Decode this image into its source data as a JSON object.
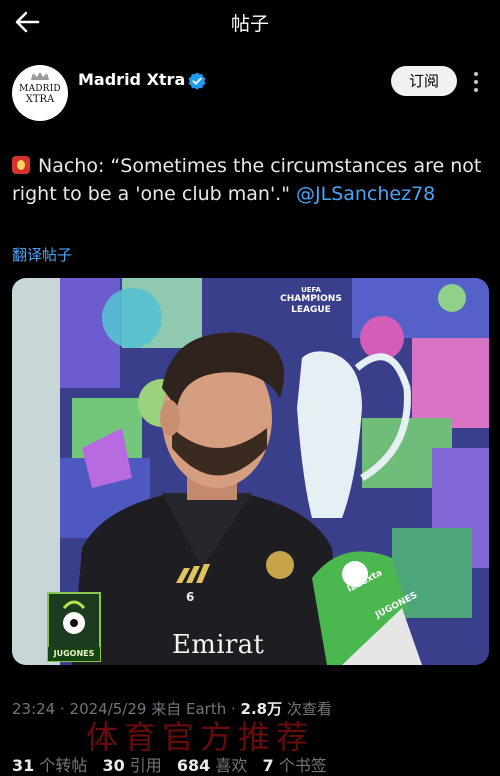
{
  "topbar": {
    "title": "帖子",
    "back_icon": "back-arrow-icon"
  },
  "account": {
    "name": "Madrid Xtra",
    "avatar_line1": "MADRID",
    "avatar_line2": "XTRA",
    "verified_icon": "verified-badge-icon",
    "follow_label": "订阅"
  },
  "post": {
    "emoji_icon": "fire-extinguisher-emoji-icon",
    "text": "Nacho: “Sometimes the circumstances are not right to be a 'one club man'.\"",
    "mention": "@JLSanchez78",
    "translate_label": "翻译帖子"
  },
  "media": {
    "ucl_top": "UEFA",
    "ucl_mid": "CHAMPIONS",
    "ucl_bot": "LEAGUE",
    "badge_label": "JUGONES",
    "shirt_brand": "Emirat",
    "shirt_number": "6",
    "mic_text1": "laSexta",
    "mic_text2": "JUGONES"
  },
  "meta": {
    "time": "23:24 · 2024/5/29 来自 Earth · ",
    "views": "2.8万",
    "views_label": " 次查看"
  },
  "stats": [
    {
      "count": "31",
      "label": " 个转帖"
    },
    {
      "count": "30",
      "label": " 引用"
    },
    {
      "count": "684",
      "label": " 喜欢"
    },
    {
      "count": "7",
      "label": " 个书签"
    }
  ],
  "watermark": "体育官方推荐",
  "colors": {
    "background": "#000000",
    "link": "#4aa3f5",
    "verified": "#1d9bf0"
  }
}
